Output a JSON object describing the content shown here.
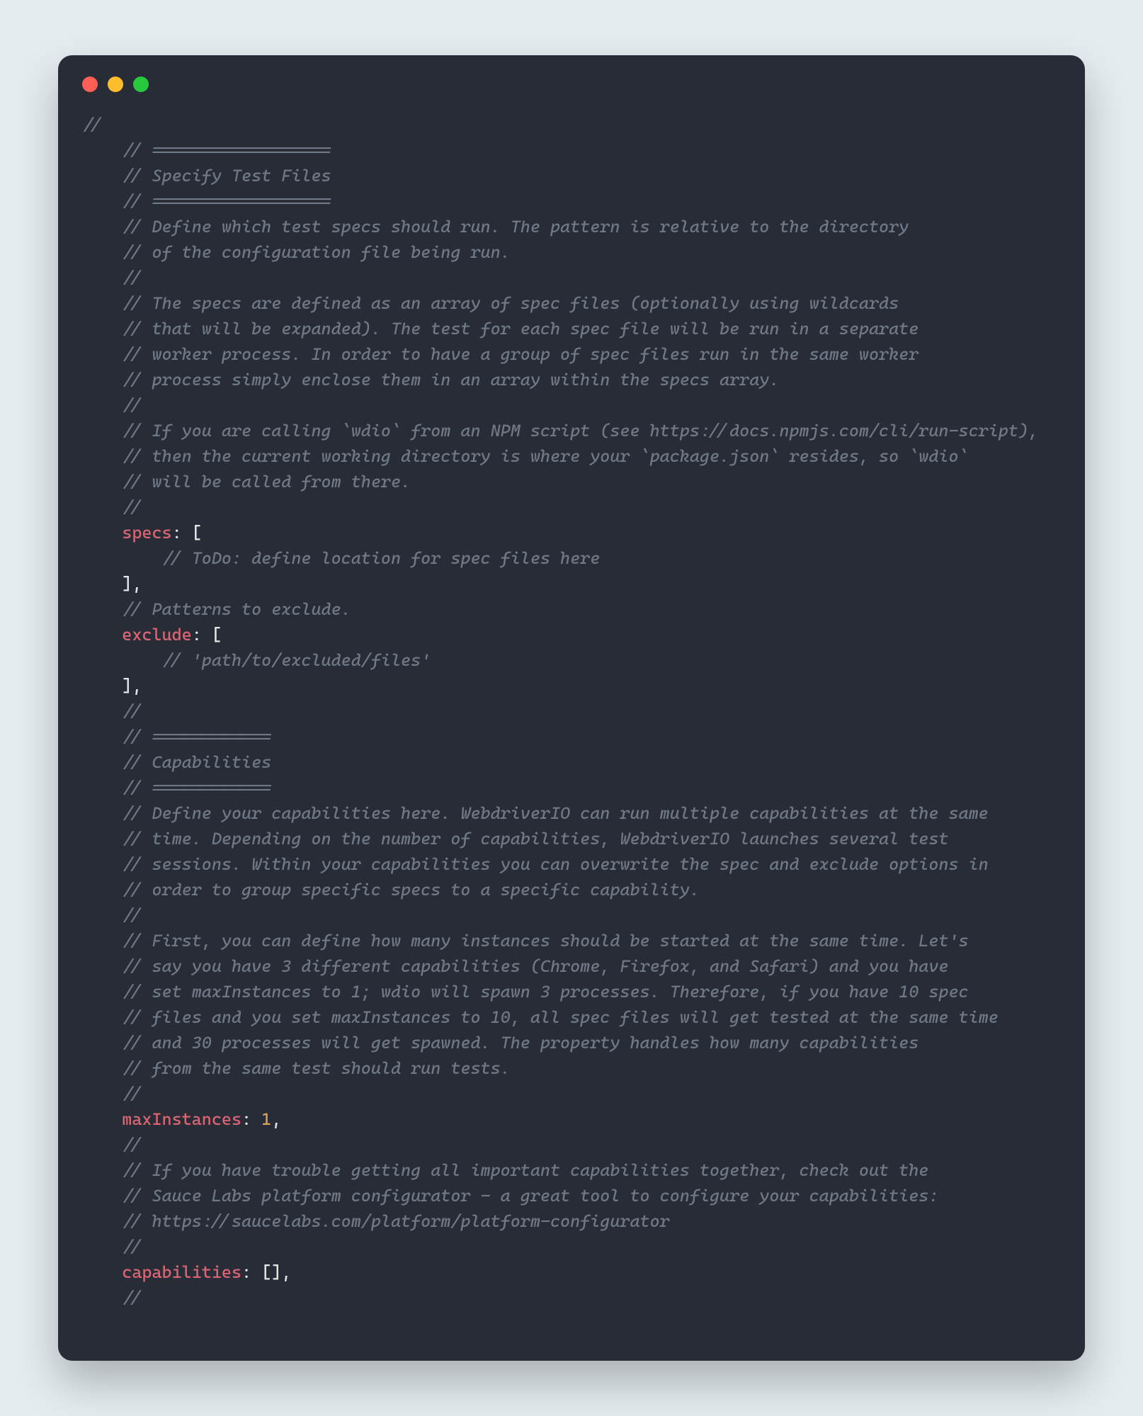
{
  "code": {
    "lines": [
      {
        "indent": 0,
        "tokens": [
          {
            "cls": "cmt",
            "t": "//"
          }
        ]
      },
      {
        "indent": 1,
        "tokens": [
          {
            "cls": "cmt",
            "t": "// =================="
          }
        ]
      },
      {
        "indent": 1,
        "tokens": [
          {
            "cls": "cmt",
            "t": "// Specify Test Files"
          }
        ]
      },
      {
        "indent": 1,
        "tokens": [
          {
            "cls": "cmt",
            "t": "// =================="
          }
        ]
      },
      {
        "indent": 1,
        "tokens": [
          {
            "cls": "cmt",
            "t": "// Define which test specs should run. The pattern is relative to the directory"
          }
        ]
      },
      {
        "indent": 1,
        "tokens": [
          {
            "cls": "cmt",
            "t": "// of the configuration file being run."
          }
        ]
      },
      {
        "indent": 1,
        "tokens": [
          {
            "cls": "cmt",
            "t": "//"
          }
        ]
      },
      {
        "indent": 1,
        "tokens": [
          {
            "cls": "cmt",
            "t": "// The specs are defined as an array of spec files (optionally using wildcards"
          }
        ]
      },
      {
        "indent": 1,
        "tokens": [
          {
            "cls": "cmt",
            "t": "// that will be expanded). The test for each spec file will be run in a separate"
          }
        ]
      },
      {
        "indent": 1,
        "tokens": [
          {
            "cls": "cmt",
            "t": "// worker process. In order to have a group of spec files run in the same worker"
          }
        ]
      },
      {
        "indent": 1,
        "tokens": [
          {
            "cls": "cmt",
            "t": "// process simply enclose them in an array within the specs array."
          }
        ]
      },
      {
        "indent": 1,
        "tokens": [
          {
            "cls": "cmt",
            "t": "//"
          }
        ]
      },
      {
        "indent": 1,
        "tokens": [
          {
            "cls": "cmt",
            "t": "// If you are calling `wdio` from an NPM script (see https://docs.npmjs.com/cli/run-script),"
          }
        ]
      },
      {
        "indent": 1,
        "tokens": [
          {
            "cls": "cmt",
            "t": "// then the current working directory is where your `package.json` resides, so `wdio`"
          }
        ]
      },
      {
        "indent": 1,
        "tokens": [
          {
            "cls": "cmt",
            "t": "// will be called from there."
          }
        ]
      },
      {
        "indent": 1,
        "tokens": [
          {
            "cls": "cmt",
            "t": "//"
          }
        ]
      },
      {
        "indent": 1,
        "tokens": [
          {
            "cls": "key",
            "t": "specs"
          },
          {
            "cls": "punct",
            "t": ": ["
          }
        ]
      },
      {
        "indent": 2,
        "tokens": [
          {
            "cls": "cmt",
            "t": "// ToDo: define location for spec files here"
          }
        ]
      },
      {
        "indent": 1,
        "tokens": [
          {
            "cls": "punct",
            "t": "],"
          }
        ]
      },
      {
        "indent": 1,
        "tokens": [
          {
            "cls": "cmt",
            "t": "// Patterns to exclude."
          }
        ]
      },
      {
        "indent": 1,
        "tokens": [
          {
            "cls": "key",
            "t": "exclude"
          },
          {
            "cls": "punct",
            "t": ": ["
          }
        ]
      },
      {
        "indent": 2,
        "tokens": [
          {
            "cls": "cmt",
            "t": "// 'path/to/excluded/files'"
          }
        ]
      },
      {
        "indent": 1,
        "tokens": [
          {
            "cls": "punct",
            "t": "],"
          }
        ]
      },
      {
        "indent": 1,
        "tokens": [
          {
            "cls": "cmt",
            "t": "//"
          }
        ]
      },
      {
        "indent": 1,
        "tokens": [
          {
            "cls": "cmt",
            "t": "// ============"
          }
        ]
      },
      {
        "indent": 1,
        "tokens": [
          {
            "cls": "cmt",
            "t": "// Capabilities"
          }
        ]
      },
      {
        "indent": 1,
        "tokens": [
          {
            "cls": "cmt",
            "t": "// ============"
          }
        ]
      },
      {
        "indent": 1,
        "tokens": [
          {
            "cls": "cmt",
            "t": "// Define your capabilities here. WebdriverIO can run multiple capabilities at the same"
          }
        ]
      },
      {
        "indent": 1,
        "tokens": [
          {
            "cls": "cmt",
            "t": "// time. Depending on the number of capabilities, WebdriverIO launches several test"
          }
        ]
      },
      {
        "indent": 1,
        "tokens": [
          {
            "cls": "cmt",
            "t": "// sessions. Within your capabilities you can overwrite the spec and exclude options in"
          }
        ]
      },
      {
        "indent": 1,
        "tokens": [
          {
            "cls": "cmt",
            "t": "// order to group specific specs to a specific capability."
          }
        ]
      },
      {
        "indent": 1,
        "tokens": [
          {
            "cls": "cmt",
            "t": "//"
          }
        ]
      },
      {
        "indent": 1,
        "tokens": [
          {
            "cls": "cmt",
            "t": "// First, you can define how many instances should be started at the same time. Let's"
          }
        ]
      },
      {
        "indent": 1,
        "tokens": [
          {
            "cls": "cmt",
            "t": "// say you have 3 different capabilities (Chrome, Firefox, and Safari) and you have"
          }
        ]
      },
      {
        "indent": 1,
        "tokens": [
          {
            "cls": "cmt",
            "t": "// set maxInstances to 1; wdio will spawn 3 processes. Therefore, if you have 10 spec"
          }
        ]
      },
      {
        "indent": 1,
        "tokens": [
          {
            "cls": "cmt",
            "t": "// files and you set maxInstances to 10, all spec files will get tested at the same time"
          }
        ]
      },
      {
        "indent": 1,
        "tokens": [
          {
            "cls": "cmt",
            "t": "// and 30 processes will get spawned. The property handles how many capabilities"
          }
        ]
      },
      {
        "indent": 1,
        "tokens": [
          {
            "cls": "cmt",
            "t": "// from the same test should run tests."
          }
        ]
      },
      {
        "indent": 1,
        "tokens": [
          {
            "cls": "cmt",
            "t": "//"
          }
        ]
      },
      {
        "indent": 1,
        "tokens": [
          {
            "cls": "key",
            "t": "maxInstances"
          },
          {
            "cls": "punct",
            "t": ": "
          },
          {
            "cls": "num",
            "t": "1"
          },
          {
            "cls": "punct",
            "t": ","
          }
        ]
      },
      {
        "indent": 1,
        "tokens": [
          {
            "cls": "cmt",
            "t": "//"
          }
        ]
      },
      {
        "indent": 1,
        "tokens": [
          {
            "cls": "cmt",
            "t": "// If you have trouble getting all important capabilities together, check out the"
          }
        ]
      },
      {
        "indent": 1,
        "tokens": [
          {
            "cls": "cmt",
            "t": "// Sauce Labs platform configurator - a great tool to configure your capabilities:"
          }
        ]
      },
      {
        "indent": 1,
        "tokens": [
          {
            "cls": "cmt",
            "t": "// https://saucelabs.com/platform/platform-configurator"
          }
        ]
      },
      {
        "indent": 1,
        "tokens": [
          {
            "cls": "cmt",
            "t": "//"
          }
        ]
      },
      {
        "indent": 1,
        "tokens": [
          {
            "cls": "key",
            "t": "capabilities"
          },
          {
            "cls": "punct",
            "t": ": [],"
          }
        ]
      },
      {
        "indent": 1,
        "tokens": [
          {
            "cls": "cmt",
            "t": "//"
          }
        ]
      }
    ],
    "indentUnit": "    "
  }
}
